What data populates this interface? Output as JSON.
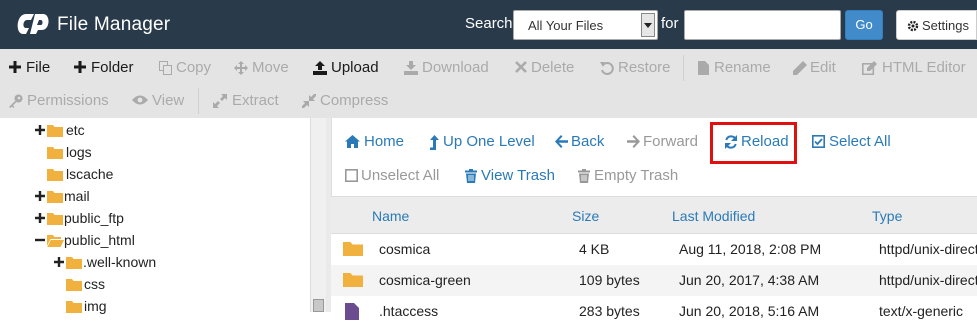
{
  "header": {
    "app_title": "File Manager",
    "search_label": "Search",
    "search_scope": "All Your Files",
    "for_label": "for",
    "search_query": "",
    "go_label": "Go",
    "settings_label": "Settings",
    "colors": {
      "bar": "#293a4a",
      "go": "#428bca"
    }
  },
  "toolbar": {
    "row1": [
      {
        "label": "File",
        "icon": "plus-icon",
        "enabled": true
      },
      {
        "label": "Folder",
        "icon": "plus-icon",
        "enabled": true
      },
      {
        "label": "Copy",
        "icon": "copy-icon",
        "enabled": false
      },
      {
        "label": "Move",
        "icon": "move-icon",
        "enabled": false
      },
      {
        "label": "Upload",
        "icon": "upload-icon",
        "enabled": true
      },
      {
        "label": "Download",
        "icon": "download-icon",
        "enabled": false
      },
      {
        "label": "Delete",
        "icon": "close-icon",
        "enabled": false
      },
      {
        "label": "Restore",
        "icon": "restore-icon",
        "enabled": false
      },
      {
        "label": "Rename",
        "icon": "file-icon",
        "enabled": false
      },
      {
        "label": "Edit",
        "icon": "pencil-icon",
        "enabled": false
      },
      {
        "label": "HTML Editor",
        "icon": "edit-square-icon",
        "enabled": false
      }
    ],
    "row2": [
      {
        "label": "Permissions",
        "icon": "key-icon",
        "enabled": false
      },
      {
        "label": "View",
        "icon": "eye-icon",
        "enabled": false
      },
      {
        "label": "Extract",
        "icon": "expand-icon",
        "enabled": false
      },
      {
        "label": "Compress",
        "icon": "compress-icon",
        "enabled": false
      }
    ]
  },
  "tree": [
    {
      "name": "etc",
      "toggle": "plus",
      "open": false
    },
    {
      "name": "logs",
      "toggle": "",
      "open": false
    },
    {
      "name": "lscache",
      "toggle": "",
      "open": false
    },
    {
      "name": "mail",
      "toggle": "plus",
      "open": false
    },
    {
      "name": "public_ftp",
      "toggle": "plus",
      "open": false
    },
    {
      "name": "public_html",
      "toggle": "minus",
      "open": true
    },
    {
      "name": ".well-known",
      "toggle": "plus",
      "open": false
    },
    {
      "name": "css",
      "toggle": "",
      "open": false
    },
    {
      "name": "img",
      "toggle": "",
      "open": false
    }
  ],
  "nav": {
    "home": "Home",
    "up_one_level": "Up One Level",
    "back": "Back",
    "forward": "Forward",
    "reload": "Reload",
    "select_all": "Select All",
    "unselect_all": "Unselect All",
    "view_trash": "View Trash",
    "empty_trash": "Empty Trash",
    "highlight_color": "#e01010"
  },
  "table": {
    "columns": [
      "Name",
      "Size",
      "Last Modified",
      "Type"
    ],
    "rows": [
      {
        "icon": "folder-icon",
        "name": "cosmica",
        "size": "4 KB",
        "modified": "Aug 11, 2018, 2:08 PM",
        "type": "httpd/unix-directory"
      },
      {
        "icon": "folder-icon",
        "name": "cosmica-green",
        "size": "109 bytes",
        "modified": "Jun 20, 2017, 4:38 AM",
        "type": "httpd/unix-directory"
      },
      {
        "icon": "text-file-icon",
        "name": ".htaccess",
        "size": "283 bytes",
        "modified": "Jun 20, 2018, 5:16 AM",
        "type": "text/x-generic"
      }
    ]
  }
}
